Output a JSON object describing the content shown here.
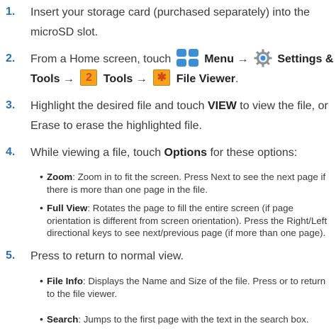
{
  "steps": [
    {
      "num": "1.",
      "lines": [
        "Insert your storage card (purchased separately) into the",
        "microSD slot."
      ]
    },
    {
      "num": "2.",
      "line1_a": "From a Home screen, touch",
      "menu": "Menu",
      "arrow": "→",
      "settings": "Settings &",
      "tools_word": "Tools",
      "key2": "2",
      "tools2": "Tools",
      "key_star": "✱",
      "file_viewer": "File Viewer",
      "period": "."
    },
    {
      "num": "3.",
      "line1_a": "Highlight the desired file and touch",
      "view": "VIEW",
      "line1_b": "to view the file, or",
      "line2": "Erase to erase the highlighted file."
    },
    {
      "num": "4.",
      "line1_a": "While viewing a file, touch",
      "options": "Options",
      "line1_b": "for these options:"
    },
    {
      "num": "5.",
      "text": "Press to return to normal view."
    }
  ],
  "bullets": [
    {
      "term": "Zoom",
      "lines": [
        ": Zoom in to fit the screen. Press Next to see the next page if",
        "there is more than one page in the file."
      ]
    },
    {
      "term": "Full View",
      "lines": [
        ": Rotates the page to fill the entire screen (if page",
        "orientation is different from screen orientation). Press the Right/Left",
        "directional keys to see next/previous page (if more than one page)."
      ]
    },
    {
      "term": "File Info",
      "lines": [
        ": Displays the Name and Size of the file. Press or to return",
        "to the file viewer."
      ]
    },
    {
      "term": "Search",
      "lines": [
        ": Jumps to the first page with the text  in the search box."
      ]
    }
  ],
  "bullet_glyph": "•",
  "colors": {
    "step_number": "#2e6fb0",
    "text": "#3a3a3a",
    "menu_icon": "#3a8fd6",
    "key_fill": "#f7a21a",
    "key_glyph": "#d14a10"
  },
  "icons": [
    "menu-grid-icon",
    "settings-gear-icon",
    "key-2-icon",
    "key-star-icon"
  ]
}
